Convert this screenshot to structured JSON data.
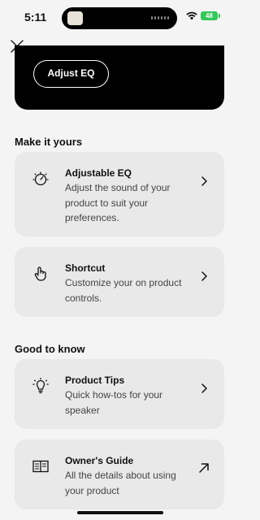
{
  "status_bar": {
    "time": "5:11",
    "battery": "48",
    "island_thumb": "ᴀ𝑦ɾ"
  },
  "header": {
    "close_icon": "close-icon"
  },
  "hero": {
    "eq_button_label": "Adjust EQ"
  },
  "sections": [
    {
      "title": "Make it yours",
      "cards": [
        {
          "icon": "dial-icon",
          "title": "Adjustable EQ",
          "description": "Adjust the sound of your product to suit your preferences.",
          "arrow": "chevron-right-icon"
        },
        {
          "icon": "touch-icon",
          "title": "Shortcut",
          "description": "Customize your on product controls.",
          "arrow": "chevron-right-icon"
        }
      ]
    },
    {
      "title": "Good to know",
      "cards": [
        {
          "icon": "lightbulb-icon",
          "title": "Product Tips",
          "description": "Quick how-tos for your speaker",
          "arrow": "chevron-right-icon"
        },
        {
          "icon": "book-icon",
          "title": "Owner's Guide",
          "description": "All the details about using your product",
          "arrow": "external-link-icon"
        }
      ]
    }
  ],
  "colors": {
    "background": "#f4f4f4",
    "card": "#e9e9e9",
    "hero": "#000000",
    "battery": "#34c759"
  }
}
